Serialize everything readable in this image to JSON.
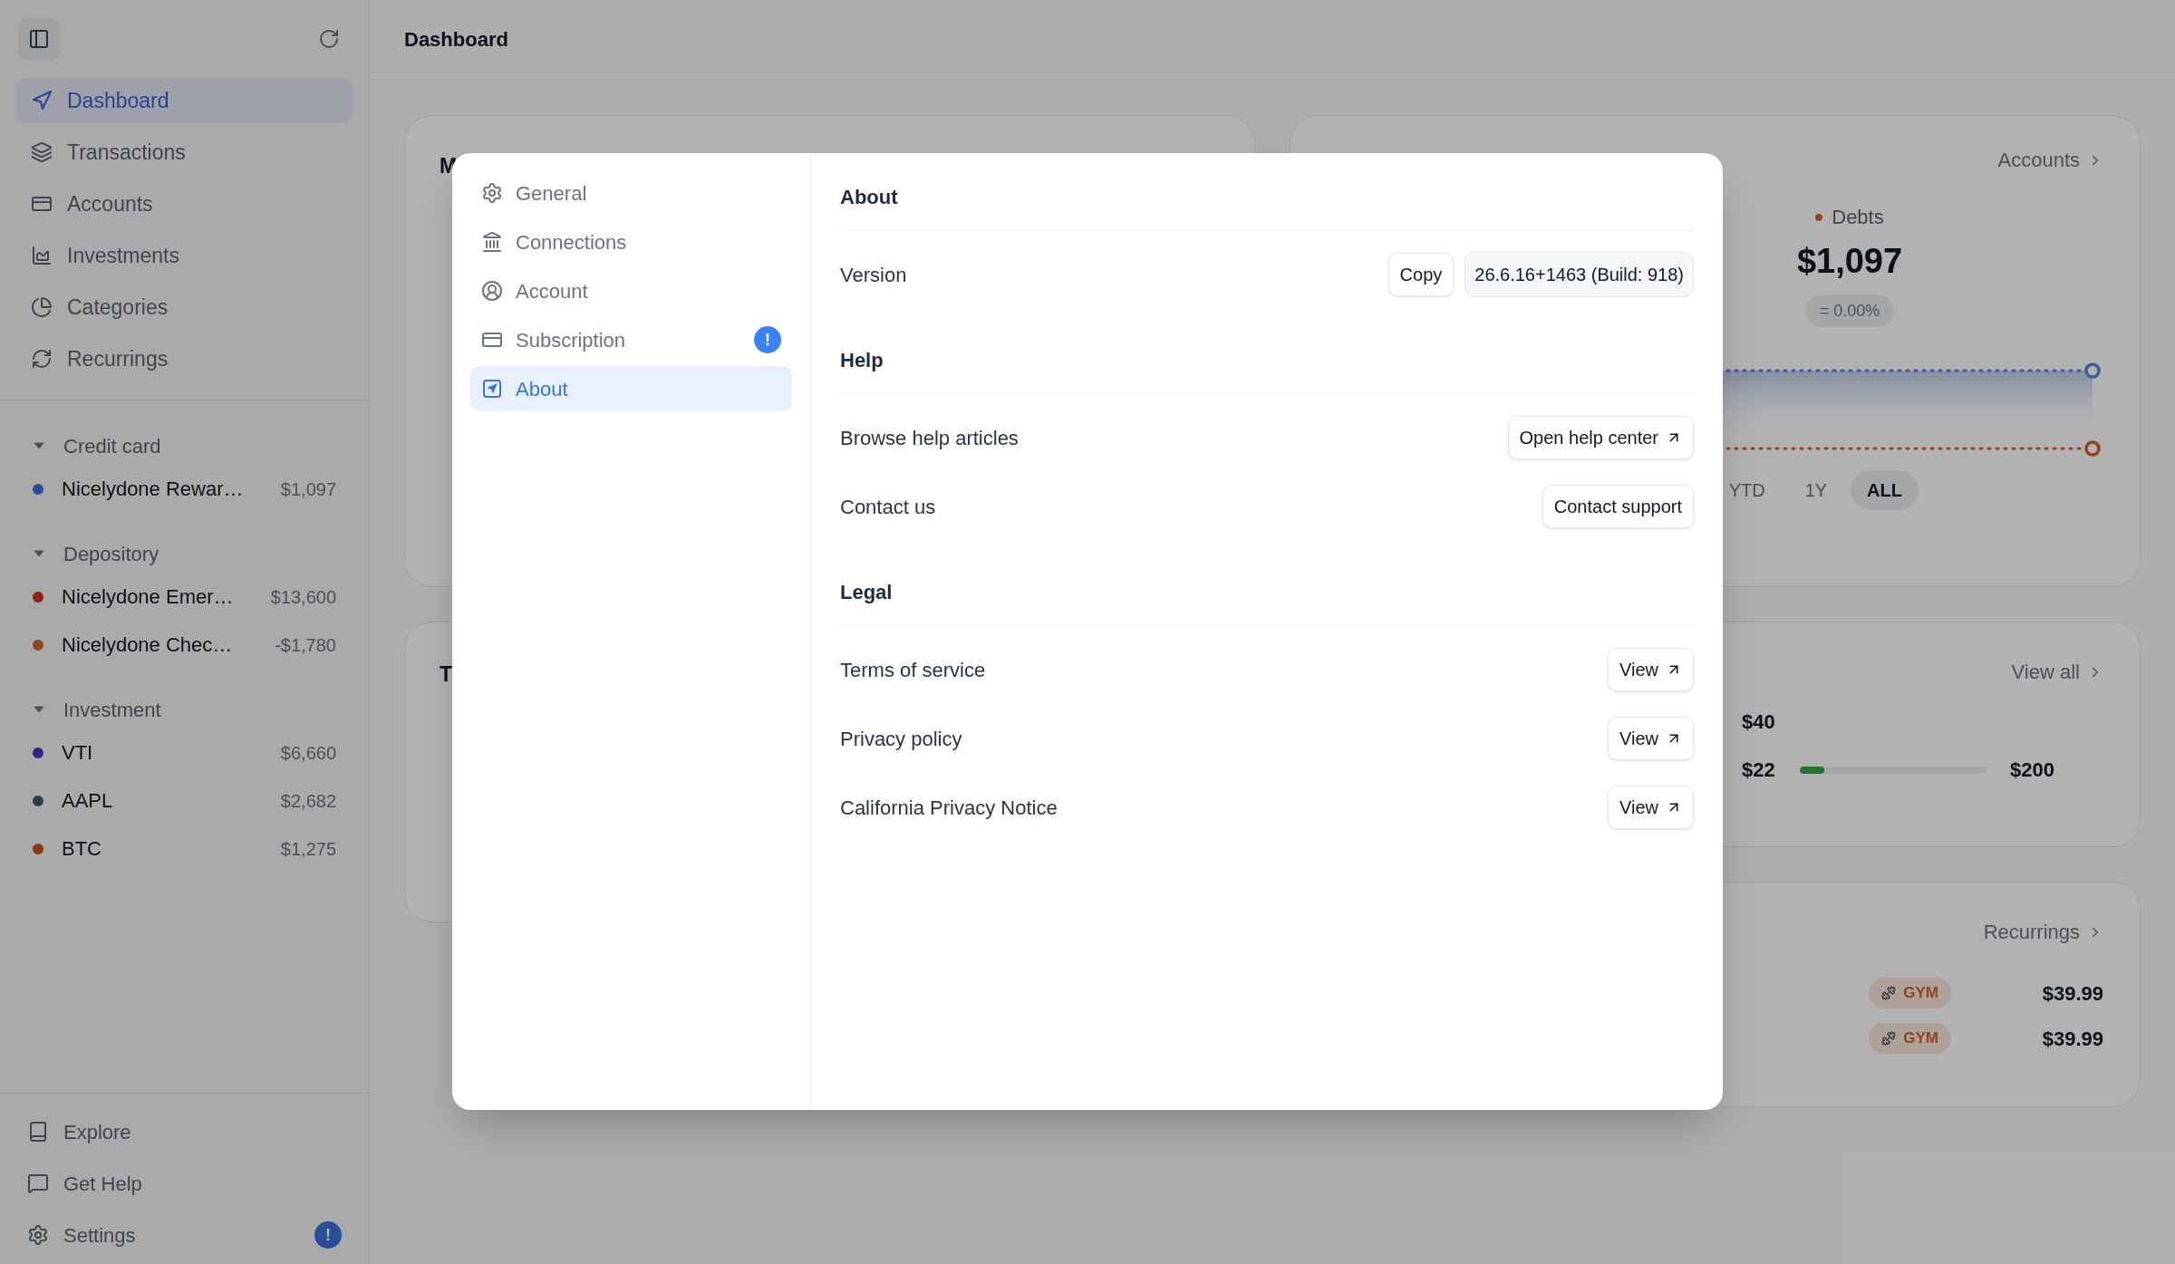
{
  "sidebar": {
    "nav": [
      {
        "label": "Dashboard",
        "selected": true
      },
      {
        "label": "Transactions",
        "selected": false
      },
      {
        "label": "Accounts",
        "selected": false
      },
      {
        "label": "Investments",
        "selected": false
      },
      {
        "label": "Categories",
        "selected": false
      },
      {
        "label": "Recurrings",
        "selected": false
      }
    ],
    "groups": [
      {
        "label": "Credit card",
        "expanded": true,
        "accounts": [
          {
            "name": "Nicelydone Rewar…",
            "amount": "$1,097",
            "color": "#294e97"
          }
        ]
      },
      {
        "label": "Depository",
        "expanded": true,
        "accounts": [
          {
            "name": "Nicelydone Emer…",
            "amount": "$13,600",
            "color": "#8c2316"
          },
          {
            "name": "Nicelydone Chec…",
            "amount": "-$1,780",
            "color": "#8c4a1e"
          }
        ]
      },
      {
        "label": "Investment",
        "expanded": true,
        "accounts": [
          {
            "name": "VTI",
            "amount": "$6,660",
            "color": "#2f278d"
          },
          {
            "name": "AAPL",
            "amount": "$2,682",
            "color": "#323c4a"
          },
          {
            "name": "BTC",
            "amount": "$1,275",
            "color": "#883c16"
          }
        ]
      }
    ],
    "footer": [
      {
        "label": "Explore"
      },
      {
        "label": "Get Help"
      },
      {
        "label": "Settings",
        "badge": "!"
      }
    ]
  },
  "header": {
    "title": "Dashboard"
  },
  "cards": {
    "summary": {
      "title": "M",
      "link": "Accounts",
      "debts_label": "Debts",
      "debts_value": "$1,097",
      "change": "= 0.00%",
      "ranges": [
        {
          "label": "YTD",
          "selected": false
        },
        {
          "label": "1Y",
          "selected": false
        },
        {
          "label": "ALL",
          "selected": true
        }
      ]
    },
    "budget": {
      "title": "T",
      "link": "View all",
      "top_value": "$40",
      "spent": "$22",
      "limit": "$200",
      "level": 0.13
    },
    "recurrings": {
      "link": "Recurrings",
      "rows": [
        {
          "tag": "GYM",
          "amount": "$39.99"
        },
        {
          "tag": "GYM",
          "amount": "$39.99"
        }
      ]
    }
  },
  "settings_dialog": {
    "nav": [
      {
        "label": "General",
        "selected": false
      },
      {
        "label": "Connections",
        "selected": false
      },
      {
        "label": "Account",
        "selected": false
      },
      {
        "label": "Subscription",
        "selected": false,
        "badge": "!"
      },
      {
        "label": "About",
        "selected": true
      }
    ],
    "sections": [
      {
        "title": "About",
        "rows": [
          {
            "label": "Version",
            "actions": [
              {
                "kind": "button",
                "label": "Copy"
              },
              {
                "kind": "value",
                "label": "26.6.16+1463 (Build: 918)"
              }
            ]
          }
        ]
      },
      {
        "title": "Help",
        "rows": [
          {
            "label": "Browse help articles",
            "actions": [
              {
                "kind": "link",
                "label": "Open help center"
              }
            ]
          },
          {
            "label": "Contact us",
            "actions": [
              {
                "kind": "button",
                "label": "Contact support"
              }
            ]
          }
        ]
      },
      {
        "title": "Legal",
        "rows": [
          {
            "label": "Terms of service",
            "actions": [
              {
                "kind": "link",
                "label": "View"
              }
            ]
          },
          {
            "label": "Privacy policy",
            "actions": [
              {
                "kind": "link",
                "label": "View"
              }
            ]
          },
          {
            "label": "California Privacy Notice",
            "actions": [
              {
                "kind": "link",
                "label": "View"
              }
            ]
          }
        ]
      }
    ]
  }
}
